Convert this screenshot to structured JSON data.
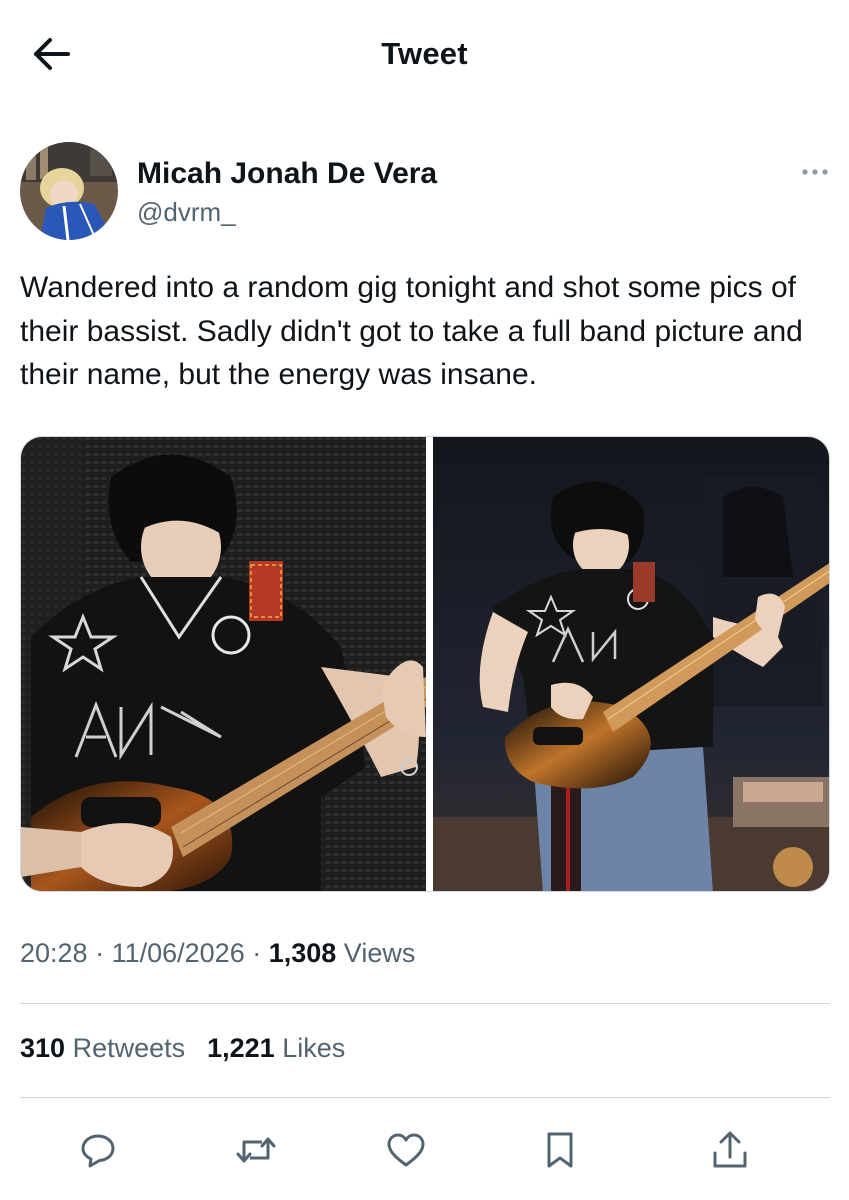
{
  "header": {
    "title": "Tweet",
    "back_icon": "arrow-left-icon"
  },
  "author": {
    "display_name": "Micah Jonah De Vera",
    "handle": "@dvrm_",
    "more_icon": "more-horizontal-icon"
  },
  "tweet": {
    "text": "Wandered into a random gig tonight and shot some pics of their bassist. Sadly didn't got to take a full band picture and their name, but the energy was insane.",
    "photos": [
      {
        "icon": "photo-bassist-closeup"
      },
      {
        "icon": "photo-bassist-stage"
      }
    ]
  },
  "meta": {
    "time": "20:28",
    "separator": " · ",
    "date": "11/06/2026",
    "views_count": "1,308",
    "views_label": " Views"
  },
  "stats": {
    "retweets_count": "310",
    "retweets_label": " Retweets",
    "likes_count": "1,221",
    "likes_label": " Likes"
  },
  "actions": [
    {
      "icon": "reply-icon"
    },
    {
      "icon": "retweet-icon"
    },
    {
      "icon": "like-icon"
    },
    {
      "icon": "bookmark-icon"
    },
    {
      "icon": "share-icon"
    }
  ],
  "colors": {
    "text_primary": "#0f1419",
    "text_secondary": "#536471",
    "divider": "#cfd9de",
    "background": "#ffffff"
  }
}
